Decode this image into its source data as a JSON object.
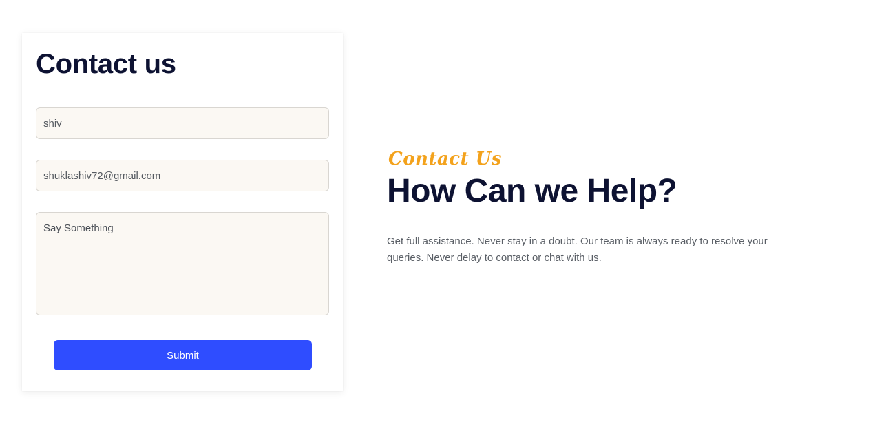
{
  "form": {
    "title": "Contact us",
    "name_value": "shiv",
    "email_value": "shuklashiv72@gmail.com",
    "message_placeholder": "Say Something",
    "submit_label": "Submit"
  },
  "info": {
    "eyebrow": "Contact Us",
    "headline": "How Can we Help?",
    "description": "Get full assistance. Never stay in a doubt. Our team is always ready to resolve your queries. Never delay to contact or chat with us."
  },
  "colors": {
    "accent": "#2f4dff",
    "eyebrow": "#f3a21c",
    "heading": "#0d1232",
    "input_bg": "#fbf8f3"
  }
}
